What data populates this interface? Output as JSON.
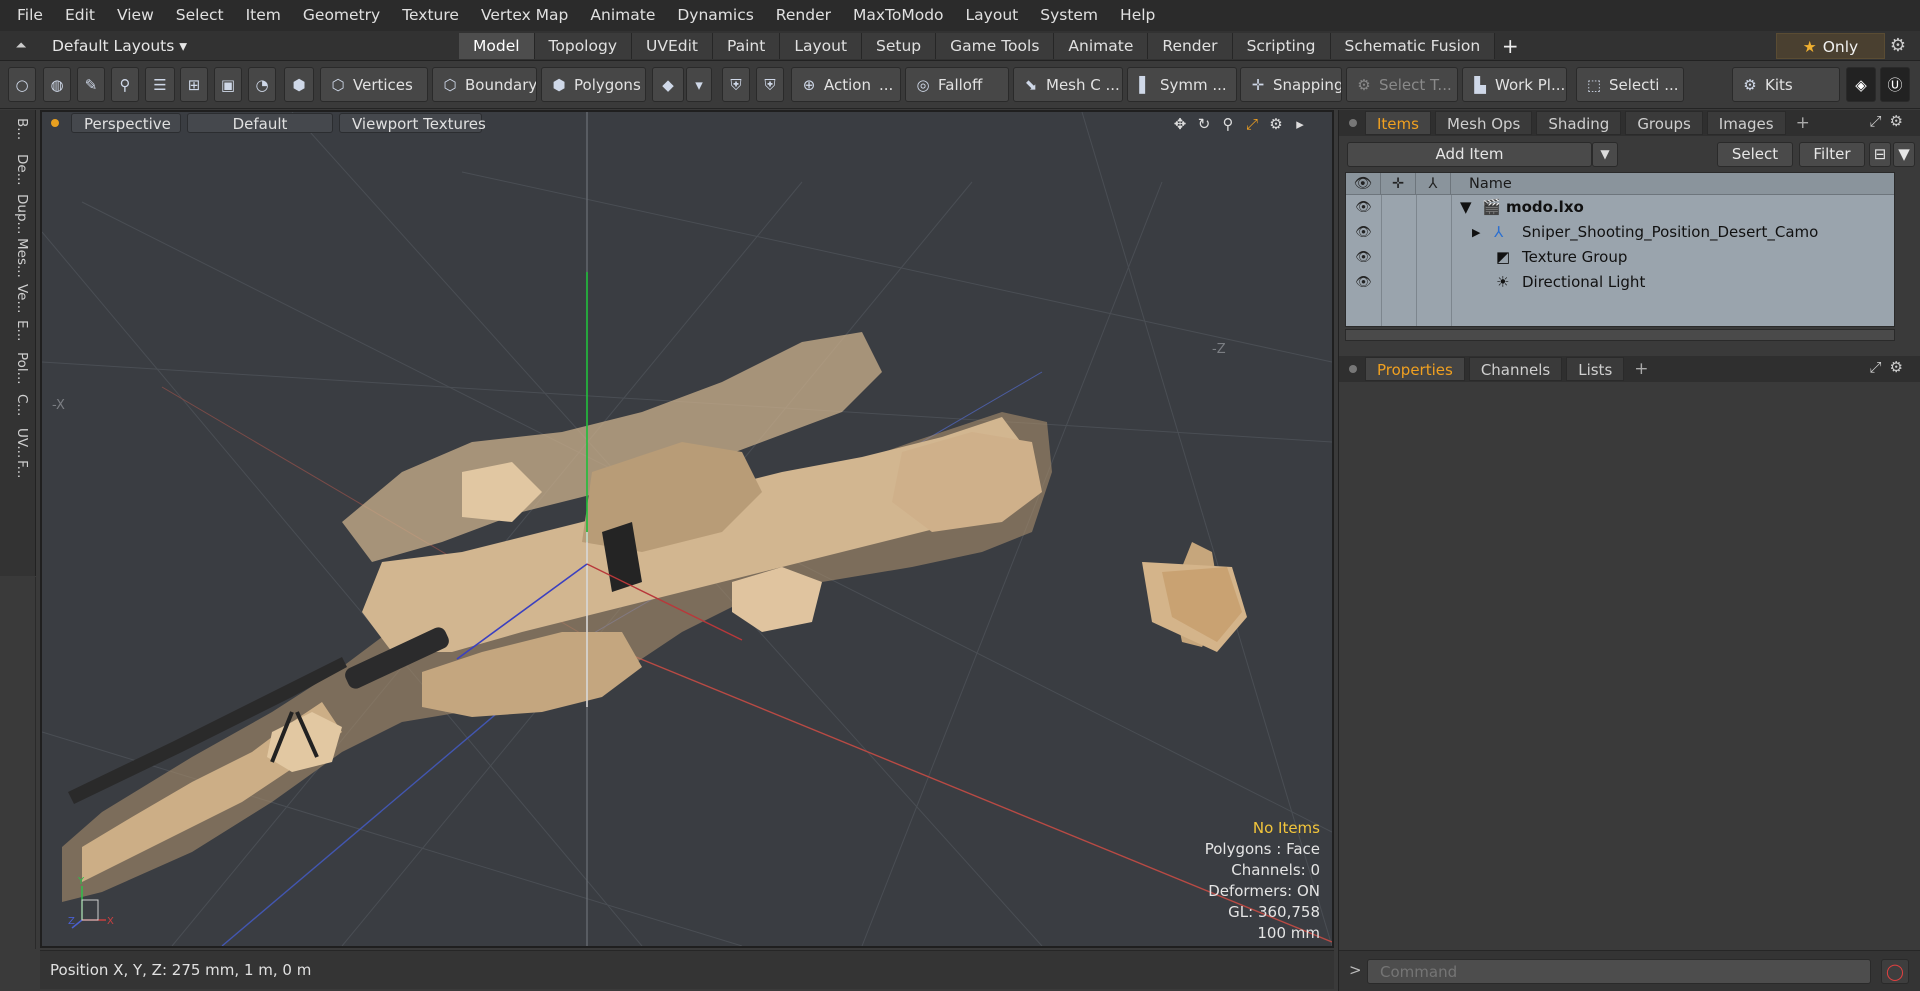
{
  "menu": [
    "File",
    "Edit",
    "View",
    "Select",
    "Item",
    "Geometry",
    "Texture",
    "Vertex Map",
    "Animate",
    "Dynamics",
    "Render",
    "MaxToModo",
    "Layout",
    "System",
    "Help"
  ],
  "layout": {
    "preset": "Default Layouts ▾",
    "tabs": [
      "Model",
      "Topology",
      "UVEdit",
      "Paint",
      "Layout",
      "Setup",
      "Game Tools",
      "Animate",
      "Render",
      "Scripting",
      "Schematic Fusion"
    ],
    "active_tab": "Model",
    "add": "+",
    "only_label": "Only"
  },
  "toolbar": {
    "vertices": "Vertices",
    "boundary": "Boundary",
    "polygons": "Polygons",
    "action": "Action",
    "action_more": "...",
    "falloff": "Falloff",
    "mesh": "Mesh C ...",
    "symmetry": "Symm ...",
    "snapping": "Snapping",
    "select_t": "Select T...",
    "workplane": "Work Pl...",
    "selection": "Selecti ...",
    "kits": "Kits"
  },
  "left_tabs": [
    "B...",
    "De...",
    "Dup...",
    "Mes...",
    "Ve...",
    "E...",
    "Pol...",
    "C...",
    "UV...",
    "F..."
  ],
  "viewport": {
    "view": "Perspective",
    "shading": "Default",
    "textures": "Viewport Textures",
    "axis_labels": {
      "neg_x": "-X",
      "neg_z": "-Z"
    },
    "stats": {
      "selection": "No Items",
      "polygons": "Polygons : Face",
      "channels": "Channels: 0",
      "deformers": "Deformers: ON",
      "gl": "GL: 360,758",
      "grid": "100 mm"
    },
    "mini_axis": {
      "x": "X",
      "y": "Y",
      "z": "Z"
    }
  },
  "status": {
    "position": "Position X, Y, Z:   275 mm, 1 m, 0 m"
  },
  "items_panel": {
    "tabs": [
      "Items",
      "Mesh Ops",
      "Shading",
      "Groups",
      "Images"
    ],
    "active_tab": "Items",
    "add_item": "Add Item",
    "select": "Select",
    "filter": "Filter",
    "column_name": "Name",
    "tree": [
      {
        "label": "modo.lxo",
        "level": 0,
        "expanded": true
      },
      {
        "label": "Sniper_Shooting_Position_Desert_Camo",
        "level": 1,
        "expanded": false
      },
      {
        "label": "Texture Group",
        "level": 1
      },
      {
        "label": "Directional Light",
        "level": 1
      }
    ]
  },
  "properties_panel": {
    "tabs": [
      "Properties",
      "Channels",
      "Lists"
    ],
    "active_tab": "Properties"
  },
  "command": {
    "prompt": ">",
    "placeholder": "Command"
  },
  "colors": {
    "accent": "#f0a020",
    "viewport_bg": "#3a3d42",
    "camo": "#c8a882"
  }
}
